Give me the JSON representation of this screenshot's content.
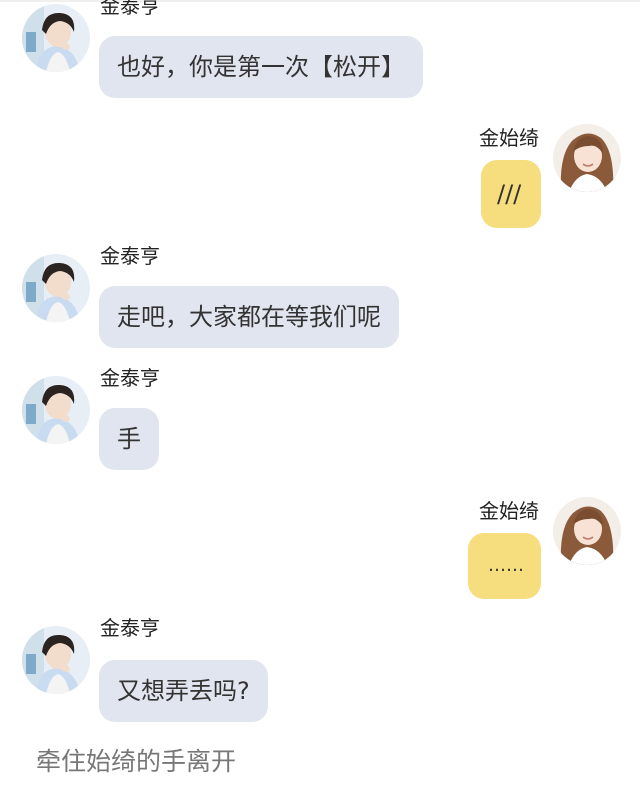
{
  "messages": [
    {
      "side": "left",
      "sender": "金泰亨",
      "text": "也好，你是第一次【松开】",
      "avatar": "male-avatar"
    },
    {
      "side": "right",
      "sender": "金始绮",
      "text": "///",
      "avatar": "female-avatar"
    },
    {
      "side": "left",
      "sender": "金泰亨",
      "text": "走吧，大家都在等我们呢",
      "avatar": "male-avatar"
    },
    {
      "side": "left",
      "sender": "金泰亨",
      "text": "手",
      "avatar": "male-avatar"
    },
    {
      "side": "right",
      "sender": "金始绮",
      "text": "……",
      "avatar": "female-avatar"
    },
    {
      "side": "left",
      "sender": "金泰亨",
      "text": "又想弄丢吗?",
      "avatar": "male-avatar"
    }
  ],
  "narration": "牵住始绮的手离开",
  "colors": {
    "left_bubble": "#e1e5ef",
    "right_bubble": "#f6dd7e",
    "background": "#ffffff"
  }
}
